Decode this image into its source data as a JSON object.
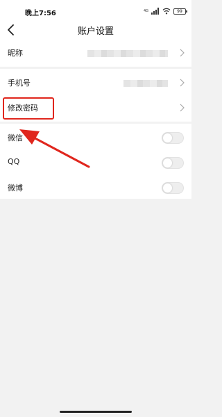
{
  "status_bar": {
    "time": "晚上7:56",
    "network": "4G",
    "battery": "99"
  },
  "header": {
    "title": "账户设置",
    "back_icon": "chevron-left-icon"
  },
  "account_rows": [
    {
      "label": "昵称"
    },
    {
      "label": "手机号"
    },
    {
      "label": "修改密码"
    }
  ],
  "social_rows": [
    {
      "label": "微信",
      "enabled": false
    },
    {
      "label": "QQ",
      "enabled": false
    },
    {
      "label": "微博",
      "enabled": false
    }
  ],
  "colors": {
    "highlight": "#e0261d",
    "toggle_off": "#eeeeee"
  }
}
